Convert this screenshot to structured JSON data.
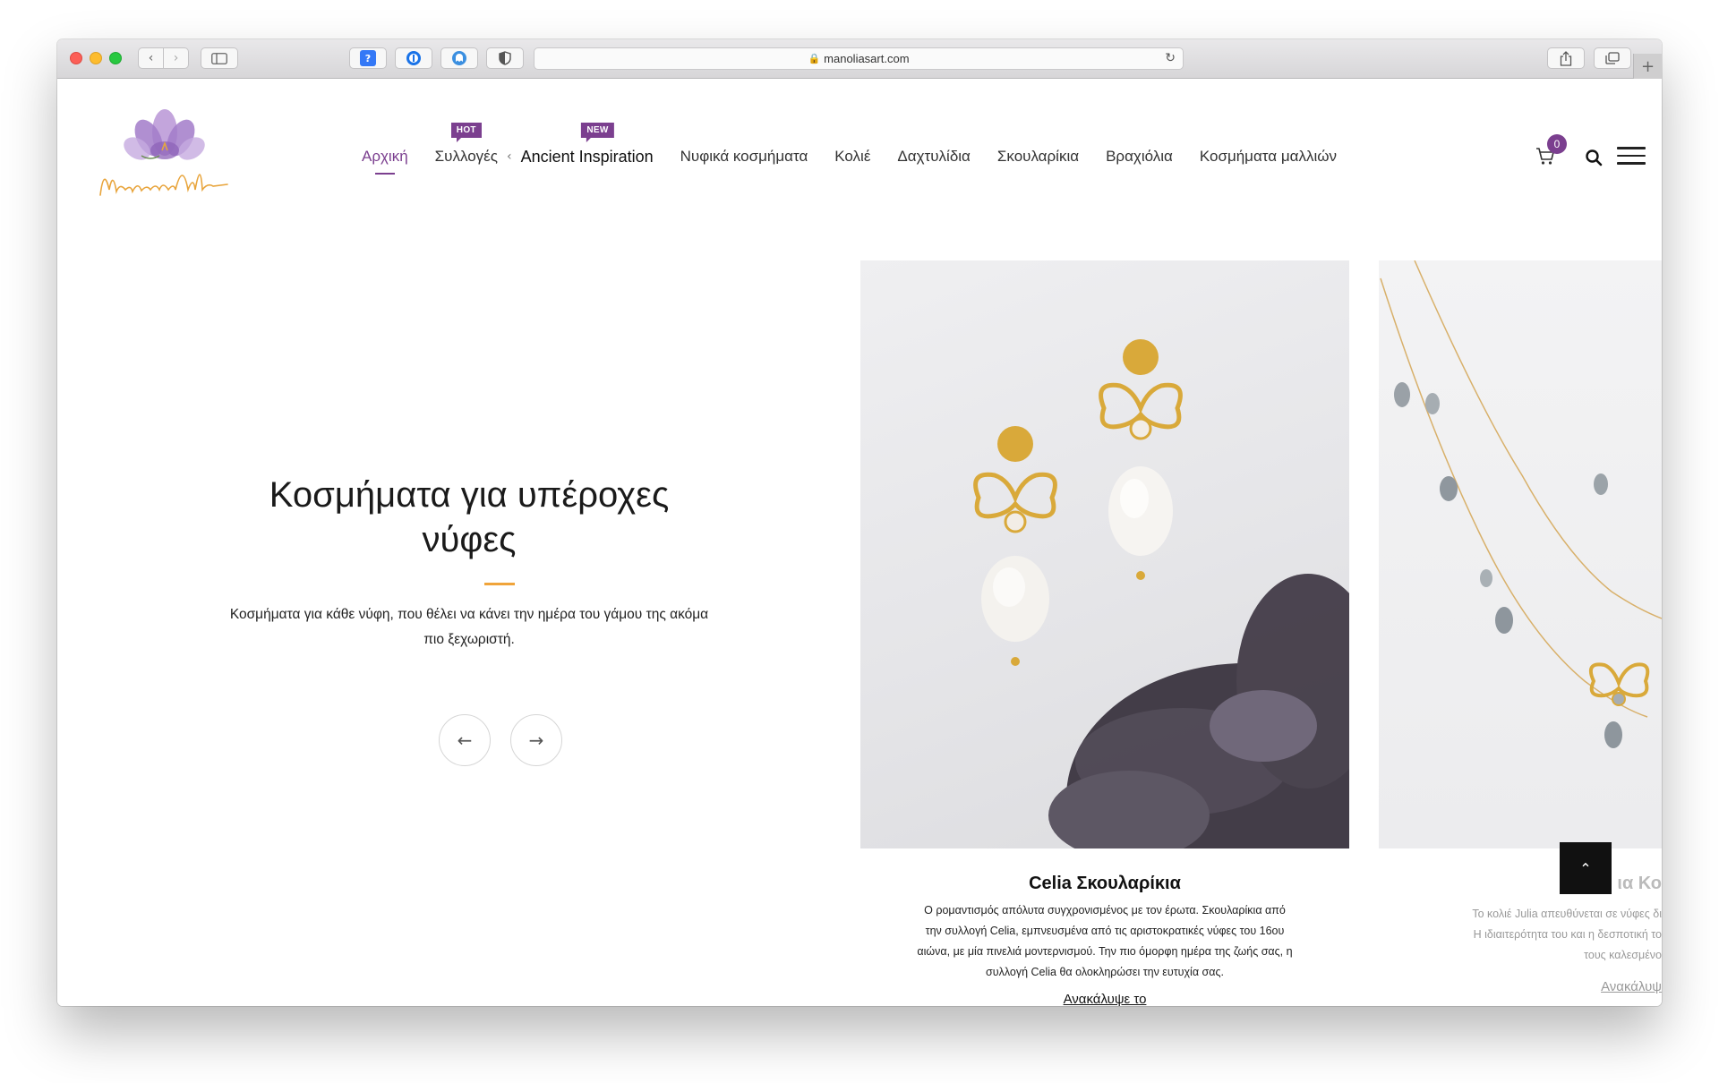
{
  "browser": {
    "url": "manoliasart.com",
    "lock_icon": "lock-icon",
    "reload_icon": "reload-icon"
  },
  "header": {
    "logo_text": "ManoliasArt",
    "nav": [
      {
        "label": "Αρχική",
        "active": true
      },
      {
        "label": "Συλλογές",
        "badge": "HOT"
      },
      {
        "label": "Ancient Inspiration",
        "badge": "NEW"
      },
      {
        "label": "Νυφικά κοσμήματα"
      },
      {
        "label": "Κολιέ"
      },
      {
        "label": "Δαχτυλίδια"
      },
      {
        "label": "Σκουλαρίκια"
      },
      {
        "label": "Βραχιόλια"
      },
      {
        "label": "Κοσμήματα μαλλιών"
      }
    ],
    "cart_count": "0"
  },
  "hero": {
    "title": "Κοσμήματα για υπέροχες νύφες",
    "subtitle": "Κοσμήματα για κάθε νύφη, που θέλει να κάνει την ημέρα του γάμου της ακόμα πιο ξεχωριστή.",
    "prev_icon": "arrow-left-icon",
    "next_icon": "arrow-right-icon"
  },
  "slides": [
    {
      "title": "Celia Σκουλαρίκια",
      "description": "Ο ρομαντισμός απόλυτα συγχρονισμένος με τον έρωτα. Σκουλαρίκια από την συλλογή Celia, εμπνευσμένα από τις αριστοκρατικές νύφες του 16ου αιώνα, με μία πινελιά μοντερνισμού. Την πιο όμορφη ημέρα της ζωής σας, η συλλογή Celia θα ολοκληρώσει την ευτυχία σας.",
      "link": "Ανακάλυψε το"
    },
    {
      "title": "ια Κο",
      "description_lines": [
        "Το κολιέ Julia απευθύνεται σε νύφες δι",
        "Η ιδιαιτερότητα του και η δεσποτική το",
        "τους καλεσμένο"
      ],
      "link": "Ανακάλυψ"
    }
  ],
  "colors": {
    "accent": "#7b3f8f",
    "divider": "#f0a43a"
  }
}
